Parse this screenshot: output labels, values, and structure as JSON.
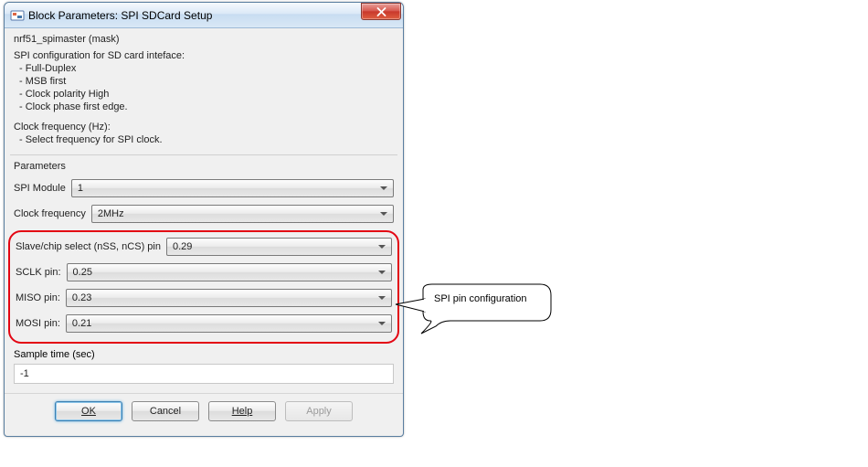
{
  "window": {
    "title": "Block Parameters: SPI SDCard Setup"
  },
  "mask": {
    "name": "nrf51_spimaster (mask)"
  },
  "description": {
    "intro": "SPI configuration for SD card inteface:",
    "bullets": [
      "- Full-Duplex",
      "- MSB first",
      "- Clock polarity High",
      "- Clock phase first edge."
    ],
    "clock_intro": "Clock frequency (Hz):",
    "clock_bullet": "- Select frequency for SPI clock."
  },
  "section": {
    "parameters": "Parameters"
  },
  "params": {
    "spi_module": {
      "label": "SPI Module",
      "value": "1"
    },
    "clock_freq": {
      "label": "Clock frequency",
      "value": "2MHz"
    },
    "nss": {
      "label": "Slave/chip select (nSS, nCS) pin",
      "value": "0.29"
    },
    "sclk": {
      "label": "SCLK pin:",
      "value": "0.25"
    },
    "miso": {
      "label": "MISO pin:",
      "value": "0.23"
    },
    "mosi": {
      "label": "MOSI pin:",
      "value": "0.21"
    },
    "sample_time": {
      "label": "Sample time (sec)",
      "value": "-1"
    }
  },
  "buttons": {
    "ok": "OK",
    "cancel": "Cancel",
    "help": "Help",
    "apply": "Apply"
  },
  "callout": {
    "text": "SPI pin configuration"
  }
}
